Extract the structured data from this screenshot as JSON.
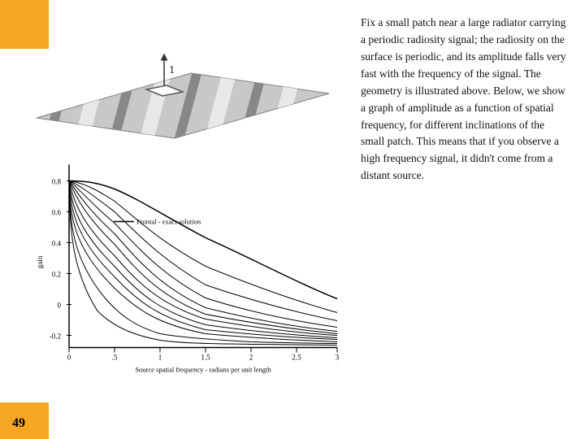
{
  "left": {
    "page_number": "49"
  },
  "graph": {
    "y_label": "gain",
    "x_label": "Source spatial frequency - radians per unit length",
    "legend": "Frontal - exact solution",
    "y_ticks": [
      "0.8",
      "0.6",
      "0.4",
      "0.2",
      "0",
      "-0.2"
    ],
    "x_ticks": [
      "0",
      "5",
      "1",
      "1.5",
      "2",
      "2.5",
      "3"
    ]
  },
  "description": {
    "text": "Fix a small patch near a large radiator carrying a periodic radiosity signal;   the radiosity on the surface is periodic, and its amplitude falls very fast with the frequency of the signal.  The geometry is illustrated above.  Below, we show a graph of amplitude as a function of spatial frequency, for different inclinations of the small patch.  This means that if you observe a high frequency signal, it didn't come from a distant source."
  },
  "illustration": {
    "label": "1"
  }
}
